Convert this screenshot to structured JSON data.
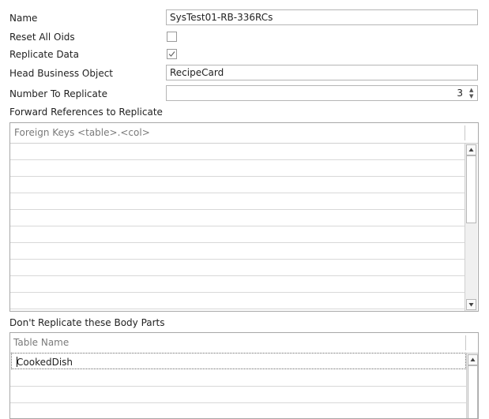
{
  "form": {
    "name_label": "Name",
    "name_value": "SysTest01-RB-336RCs",
    "reset_oids_label": "Reset All Oids",
    "reset_oids_checked": false,
    "replicate_data_label": "Replicate Data",
    "replicate_data_checked": true,
    "head_business_object_label": "Head Business Object",
    "head_business_object_value": "RecipeCard",
    "number_to_replicate_label": "Number To Replicate",
    "number_to_replicate_value": "3"
  },
  "forward_references": {
    "section_label": "Forward References to Replicate",
    "column_header": "Foreign Keys <table>.<col>",
    "rows": []
  },
  "body_parts": {
    "section_label": "Don't Replicate these Body Parts",
    "column_header": "Table Name",
    "rows": [
      "CookedDish"
    ]
  },
  "icons": {
    "checkmark": "checkmark-icon",
    "spin_up": "spin-up-icon",
    "spin_down": "spin-down-icon",
    "scroll_up": "scroll-up-arrow-icon",
    "scroll_down": "scroll-down-arrow-icon"
  }
}
